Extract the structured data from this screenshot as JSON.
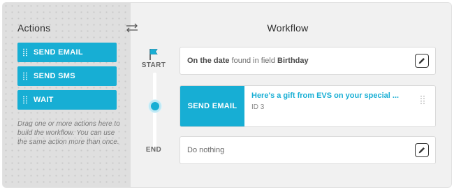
{
  "actions_panel": {
    "title": "Actions",
    "items": [
      {
        "label": "SEND EMAIL"
      },
      {
        "label": "SEND SMS"
      },
      {
        "label": "WAIT"
      }
    ],
    "hint": "Drag one or more actions here to build the workflow. You can use the same action more than once."
  },
  "workflow": {
    "title": "Workflow",
    "start_label": "START",
    "end_label": "END",
    "trigger": {
      "prefix": "On the date",
      "middle": " found in field ",
      "field": "Birthday"
    },
    "action_step": {
      "type_label": "SEND EMAIL",
      "subject": "Here's a gift from EVS on your special ...",
      "id_text": "ID 3"
    },
    "end_step": {
      "text": "Do nothing"
    }
  },
  "icons": {
    "toggle": "swap-arrows-icon",
    "flag": "flag-icon",
    "edit": "pencil-icon",
    "drag": "drag-handle-icon"
  },
  "colors": {
    "accent": "#17aed4",
    "panel_bg": "#dfdfdf",
    "workflow_bg": "#f1f1f1"
  }
}
